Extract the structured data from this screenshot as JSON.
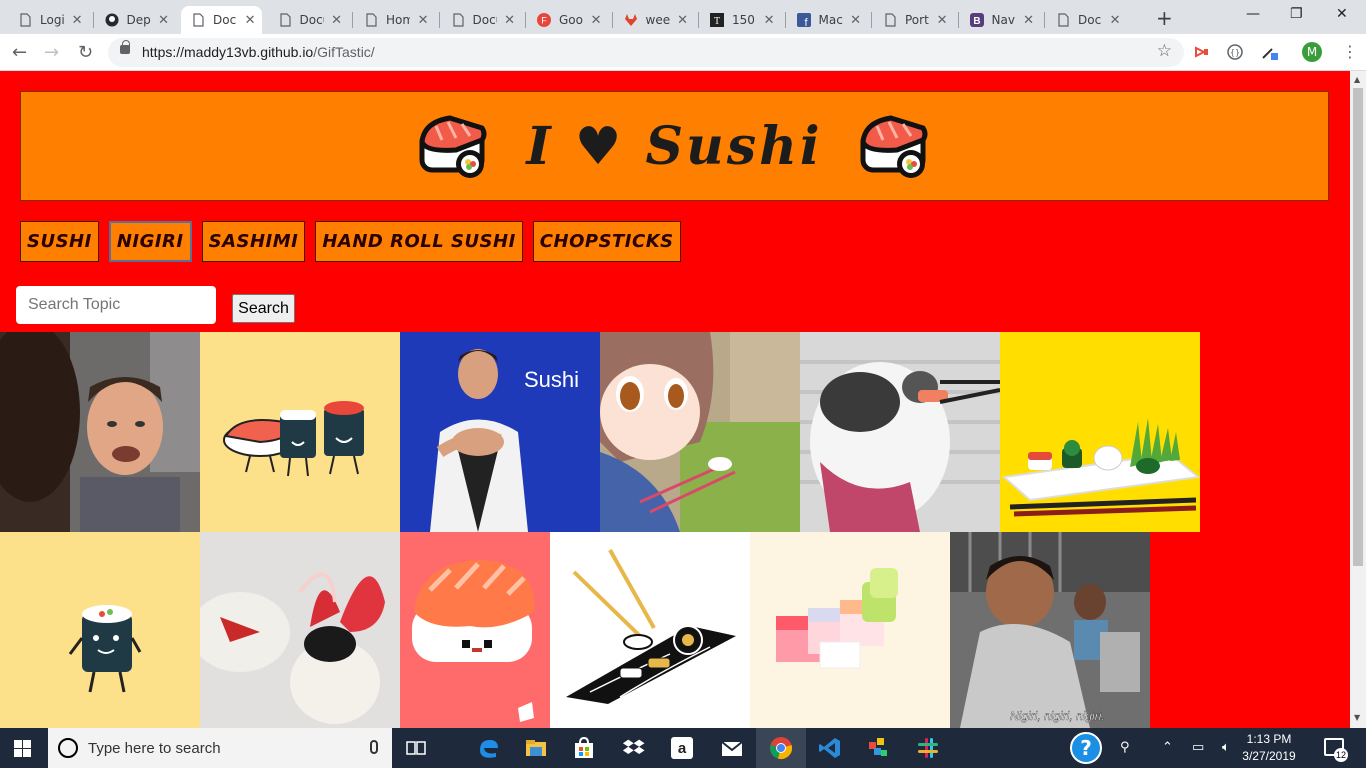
{
  "browser": {
    "tabs": [
      {
        "title": "Logi",
        "icon": "doc-icon"
      },
      {
        "title": "Depl",
        "icon": "github-icon"
      },
      {
        "title": "Docu",
        "icon": "doc-icon",
        "active": true
      },
      {
        "title": "Docu",
        "icon": "doc-icon"
      },
      {
        "title": "Hom",
        "icon": "doc-icon"
      },
      {
        "title": "Docu",
        "icon": "doc-icon"
      },
      {
        "title": "Goo",
        "icon": "google-forms-icon"
      },
      {
        "title": "wee",
        "icon": "gitlab-icon"
      },
      {
        "title": "150",
        "icon": "font-icon"
      },
      {
        "title": "Mac",
        "icon": "facebook-icon"
      },
      {
        "title": "Port",
        "icon": "doc-icon"
      },
      {
        "title": "Navi",
        "icon": "bootstrap-icon"
      },
      {
        "title": "Docu",
        "icon": "doc-icon"
      }
    ],
    "url_host": "https://maddy13vb.github.io",
    "url_path": "/GifTastic/",
    "profile_initial": "M"
  },
  "page": {
    "title_left": "I",
    "heart": "♥",
    "title_right": "Sushi",
    "topics": [
      "Sushi",
      "Nigiri",
      "Sashimi",
      "Hand Roll Sushi",
      "Chopsticks"
    ],
    "selected_topic": "Nigiri",
    "search_placeholder": "Search Topic",
    "search_button": "Search",
    "gif_captions": {
      "sushi_sign": "Sushi",
      "nigiri_subtitle": "Nigiri, nigiri, nigiri."
    }
  },
  "taskbar": {
    "search_placeholder": "Type here to search",
    "time": "1:13 PM",
    "date": "3/27/2019",
    "notification_count": "12",
    "help_label": "?"
  },
  "colors": {
    "page_background": "#ff0000",
    "header_background": "#ff7f00",
    "button_background": "#ff7f00"
  }
}
